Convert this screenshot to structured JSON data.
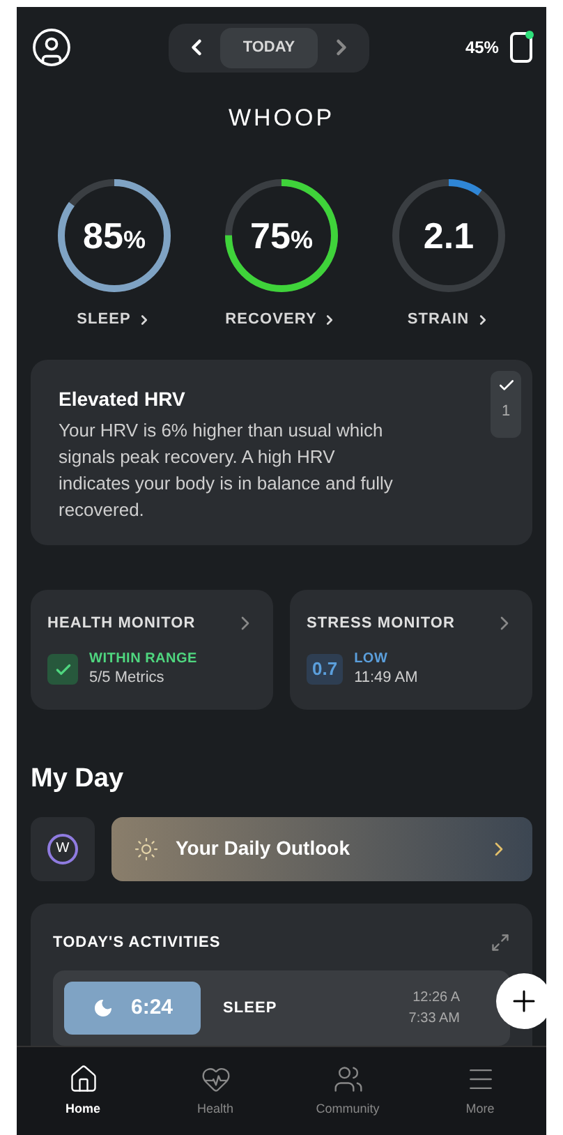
{
  "top_bar": {
    "date_label": "TODAY",
    "battery": "45%"
  },
  "logo": "WHOOP",
  "rings": [
    {
      "value": "85",
      "unit": "%",
      "label": "SLEEP",
      "level": 0.85,
      "color": "#7fa3c4"
    },
    {
      "value": "75",
      "unit": "%",
      "label": "RECOVERY",
      "level": 0.75,
      "color": "#3fd33a"
    },
    {
      "value": "2.1",
      "label": "STRAIN",
      "level": 0.1,
      "color": "#2f86d6"
    }
  ],
  "insight": {
    "title": "Elevated HRV",
    "text": "Your HRV is 6% higher than usual which signals peak recovery. A high HRV indicates your body is in balance and fully recovered.",
    "count": "1"
  },
  "monitors": [
    {
      "kind": "check",
      "title": "HEALTH MONITOR",
      "status": "WITHIN RANGE",
      "detail": "5/5 Metrics",
      "color": "#4fd67f"
    },
    {
      "kind": "score",
      "title": "STRESS MONITOR",
      "badge": "0.7",
      "status": "LOW",
      "detail": "11:49 AM",
      "color": "#5b9fdc"
    }
  ],
  "my_day": {
    "title": "My Day",
    "coach_logo": "W",
    "outlook": "Your Daily Outlook"
  },
  "activities": {
    "title": "TODAY'S ACTIVITIES",
    "items": [
      {
        "duration": "6:24",
        "name": "SLEEP",
        "start": "12:26 A",
        "end": "7:33 AM"
      }
    ]
  },
  "nav": [
    {
      "label": "Home",
      "selected": true
    },
    {
      "label": "Health",
      "selected": false
    },
    {
      "label": "Community",
      "selected": false
    },
    {
      "label": "More",
      "selected": false
    }
  ]
}
